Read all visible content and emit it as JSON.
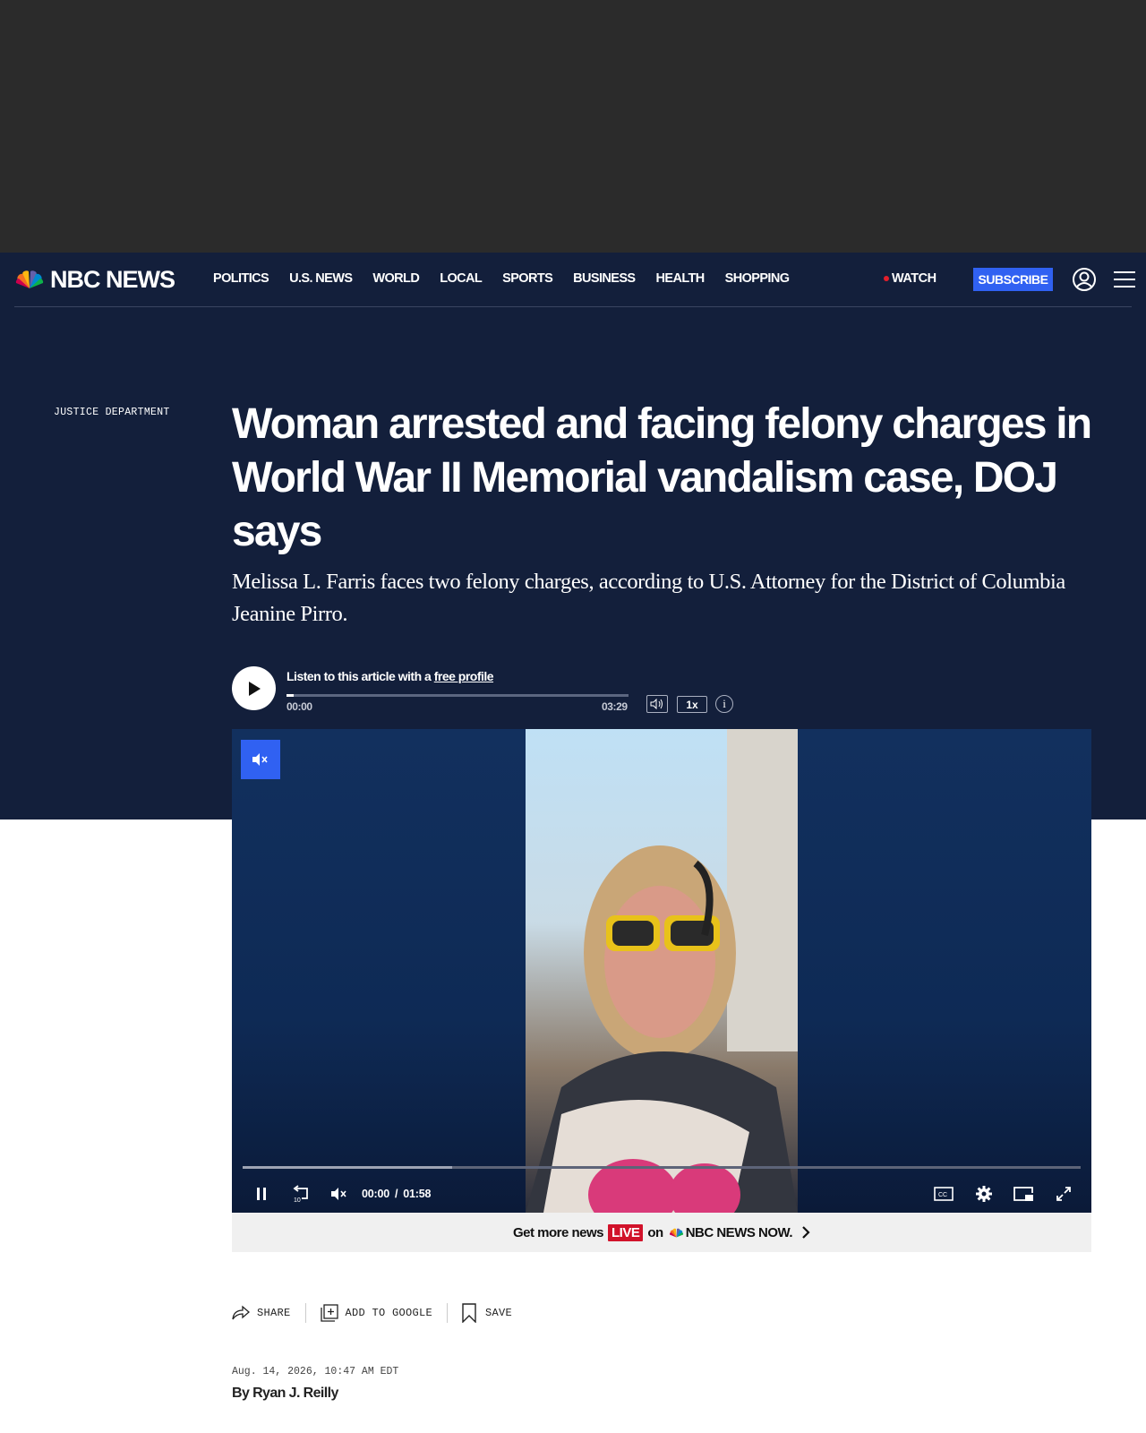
{
  "header": {
    "logo_text": "NBC NEWS",
    "nav_items": [
      "POLITICS",
      "U.S. NEWS",
      "WORLD",
      "LOCAL",
      "SPORTS",
      "BUSINESS",
      "HEALTH",
      "SHOPPING"
    ],
    "watch_label": "WATCH",
    "subscribe_label": "SUBSCRIBE"
  },
  "article": {
    "section": "JUSTICE DEPARTMENT",
    "headline": "Woman arrested and facing felony charges in World War II Memorial vandalism case, DOJ says",
    "dek": "Melissa L. Farris faces two felony charges, according to U.S. Attorney for the District of Columbia Jeanine Pirro.",
    "date": "Aug. 14, 2026, 10:47 AM EDT",
    "byline": "By Ryan J. Reilly"
  },
  "audio_player": {
    "listen_prefix": "Listen to this article with a ",
    "listen_link": "free profile",
    "time_current": "00:00",
    "time_total": "03:29",
    "speed": "1x",
    "info": "i",
    "progress_fraction": 0.0
  },
  "video_player": {
    "time_current": "00:00",
    "time_separator": "/",
    "time_total": "01:58",
    "buffer_fraction": 0.25
  },
  "live_banner": {
    "prefix": "Get more news",
    "live_label": "LIVE",
    "on_text": "on",
    "brand": "NBC NEWS NOW."
  },
  "actions": {
    "share": "SHARE",
    "add_to_google": "ADD TO GOOGLE",
    "save": "SAVE"
  },
  "colors": {
    "hero_background": "#131f3b",
    "accent_blue": "#3061f2",
    "live_red": "#d1122a"
  }
}
